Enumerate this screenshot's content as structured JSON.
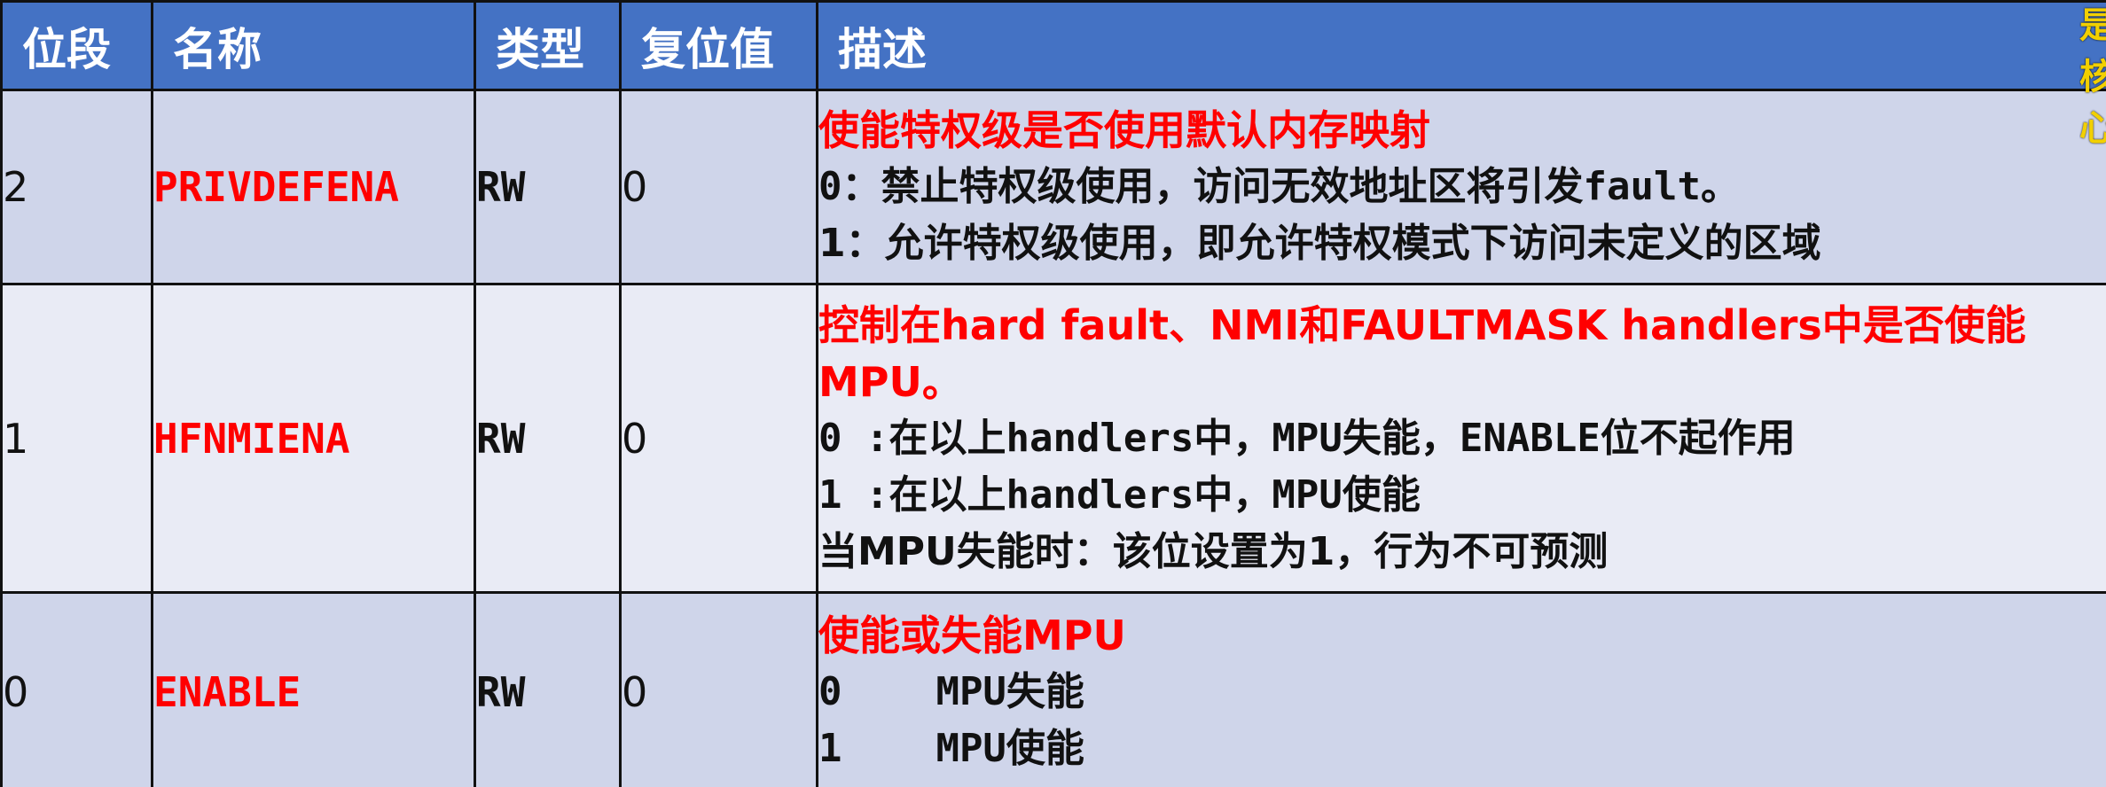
{
  "headers": [
    "位段",
    "名称",
    "类型",
    "复位值",
    "描述"
  ],
  "rows": [
    {
      "bit": "2",
      "name": "PRIVDEFENA",
      "type": "RW",
      "reset": "0",
      "desc_title": "使能特权级是否使用默认内存映射",
      "desc_lines": [
        "0：禁止特权级使用，访问无效地址区将引发fault。",
        "1：允许特权级使用，即允许特权模式下访问未定义的区域"
      ]
    },
    {
      "bit": "1",
      "name": "HFNMIENA",
      "type": "RW",
      "reset": "0",
      "desc_title": "控制在hard fault、NMI和FAULTMASK handlers中是否使能MPU。",
      "desc_lines": [
        "0 :在以上handlers中，MPU失能，ENABLE位不起作用",
        "1 :在以上handlers中，MPU使能",
        "当MPU失能时：该位设置为1，行为不可预测"
      ]
    },
    {
      "bit": "0",
      "name": "ENABLE",
      "type": "RW",
      "reset": "0",
      "desc_title": "使能或失能MPU",
      "desc_lines": [
        "0    MPU失能",
        "1    MPU使能"
      ]
    }
  ],
  "edge_text": "是核心",
  "colors": {
    "header_bg": "#4472c4",
    "row_dark": "#cfd5ea",
    "row_light": "#e9ebf5",
    "accent_red": "#ff0000"
  }
}
